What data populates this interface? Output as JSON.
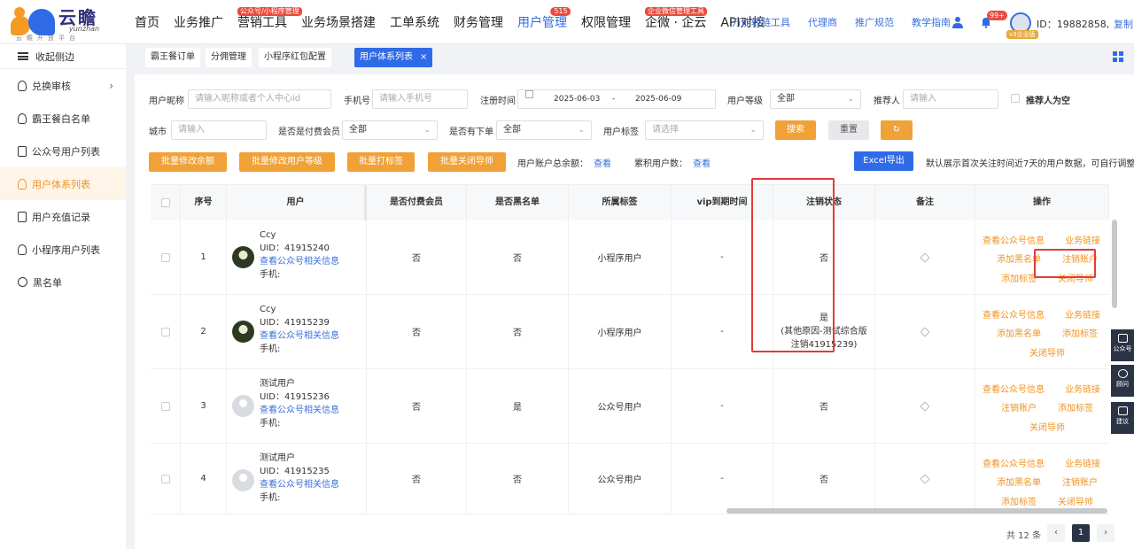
{
  "header": {
    "brand_name": "云瞻",
    "brand_en": "yunzhan",
    "brand_sub": "云瞻开放平台",
    "nav": [
      {
        "label": "首页"
      },
      {
        "label": "业务推广"
      },
      {
        "label": "营销工具",
        "badge": "公众号/小程序管理"
      },
      {
        "label": "业务场景搭建"
      },
      {
        "label": "工单系统"
      },
      {
        "label": "财务管理"
      },
      {
        "label": "用户管理",
        "badge": "515",
        "active": true
      },
      {
        "label": "权限管理"
      },
      {
        "label": "企微 · 企云",
        "badge": "企业微信管理工具"
      },
      {
        "label": "API对接"
      }
    ],
    "links": [
      "万能转链工具",
      "代理商",
      "推广规范",
      "教学指南"
    ],
    "bell_badge": "99+",
    "vip_tag": "v3企业版",
    "user_id": "ID：19882858,",
    "copy_label": "复制"
  },
  "sidebar": {
    "collapse_label": "收起侧边",
    "items": [
      {
        "label": "兑换审核",
        "has_children": true
      },
      {
        "label": "霸王餐白名单"
      },
      {
        "label": "公众号用户列表"
      },
      {
        "label": "用户体系列表",
        "active": true
      },
      {
        "label": "用户充值记录"
      },
      {
        "label": "小程序用户列表"
      },
      {
        "label": "黑名单"
      }
    ]
  },
  "tabs": [
    {
      "label": "霸王餐订单"
    },
    {
      "label": "分佣管理"
    },
    {
      "label": "小程序红包配置"
    },
    {
      "label": "用户体系列表",
      "active": true,
      "close": "×"
    }
  ],
  "filters": {
    "nickname_label": "用户昵称",
    "nickname_placeholder": "请输入昵称或者个人中心id",
    "phone_label": "手机号",
    "phone_placeholder": "请输入手机号",
    "reg_time_label": "注册时间",
    "date_start": "2025-06-03",
    "date_sep": "-",
    "date_end": "2025-06-09",
    "level_label": "用户等级",
    "level_value": "全部",
    "referrer_label": "推荐人",
    "referrer_placeholder": "请输入",
    "referrer_empty_label": "推荐人为空",
    "city_label": "城市",
    "city_placeholder": "请输入",
    "paid_member_label": "是否是付费会员",
    "paid_member_value": "全部",
    "has_order_label": "是否有下单",
    "has_order_value": "全部",
    "user_tag_label": "用户标签",
    "user_tag_placeholder": "请选择",
    "search_label": "搜索",
    "reset_label": "重置",
    "refresh_icon": "refresh-icon"
  },
  "actions": {
    "batch_balance": "批量修改余额",
    "batch_level": "批量修改用户等级",
    "batch_tag": "批量打标签",
    "batch_close_guide": "批量关闭导师",
    "total_balance_label": "用户账户总余额：",
    "total_balance_link": "查看",
    "total_users_label": "累积用户数：",
    "total_users_link": "查看",
    "excel_label": "Excel导出",
    "note": "默认展示首次关注时间近7天的用户数据，可自行调整"
  },
  "table": {
    "columns": [
      "序号",
      "用户",
      "是否付费会员",
      "是否黑名单",
      "所属标签",
      "vip到期时间",
      "注销状态",
      "备注",
      "操作"
    ],
    "rows": [
      {
        "index": "1",
        "name": "Ccy",
        "uid": "UID：41915240",
        "link": "查看公众号相关信息",
        "phone": "手机:",
        "avatar": "photo",
        "paid": "否",
        "blacklist": "否",
        "tag": "小程序用户",
        "vip": "-",
        "cancel": [
          "否"
        ],
        "ops": [
          "查看公众号信息",
          "业务链接",
          "添加黑名单",
          "注销账户",
          "添加标签",
          "关闭导师"
        ]
      },
      {
        "index": "2",
        "name": "Ccy",
        "uid": "UID：41915239",
        "link": "查看公众号相关信息",
        "phone": "手机:",
        "avatar": "photo",
        "paid": "否",
        "blacklist": "否",
        "tag": "小程序用户",
        "vip": "-",
        "cancel": [
          "是",
          "(其他原因-测试综合版",
          "注销41915239)"
        ],
        "ops": [
          "查看公众号信息",
          "业务链接",
          "添加黑名单",
          "添加标签",
          "关闭导师"
        ]
      },
      {
        "index": "3",
        "name": "测试用户",
        "uid": "UID：41915236",
        "link": "查看公众号相关信息",
        "phone": "手机:",
        "avatar": "blank",
        "paid": "否",
        "blacklist": "是",
        "tag": "公众号用户",
        "vip": "-",
        "cancel": [
          "否"
        ],
        "ops": [
          "查看公众号信息",
          "业务链接",
          "注销账户",
          "添加标签",
          "关闭导师"
        ]
      },
      {
        "index": "4",
        "name": "测试用户",
        "uid": "UID：41915235",
        "link": "查看公众号相关信息",
        "phone": "手机:",
        "avatar": "blank",
        "paid": "否",
        "blacklist": "否",
        "tag": "公众号用户",
        "vip": "-",
        "cancel": [
          "否"
        ],
        "ops": [
          "查看公众号信息",
          "业务链接",
          "添加黑名单",
          "注销账户",
          "添加标签",
          "关闭导师"
        ]
      }
    ]
  },
  "pagination": {
    "total": "共 12 条",
    "prev": "‹",
    "current": "1",
    "next": "›"
  },
  "float_tools": [
    "公众号",
    "顾问",
    "建议"
  ],
  "colors": {
    "accent": "#2f6be6",
    "orange": "#f0a137",
    "annotation_red": "#e23a3a"
  }
}
